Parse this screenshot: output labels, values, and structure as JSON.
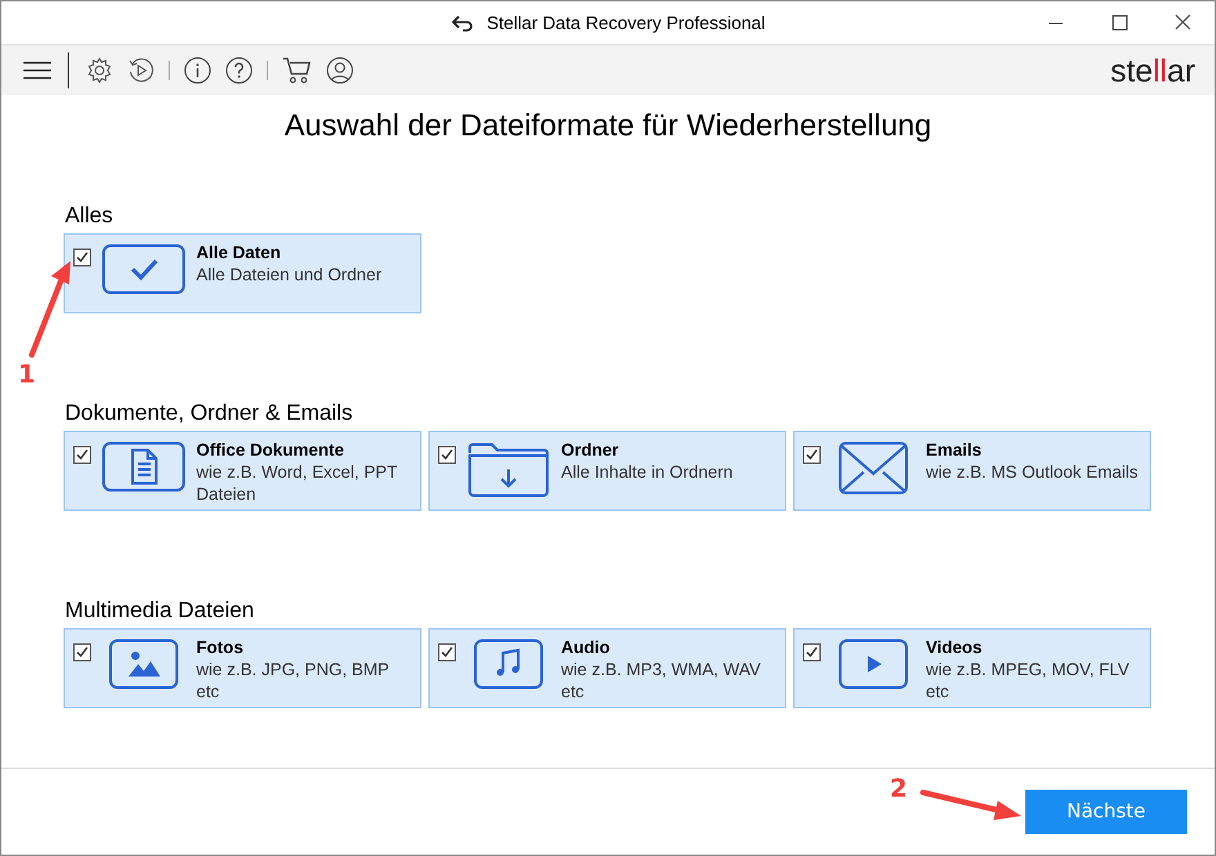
{
  "window": {
    "title": "Stellar Data Recovery Professional"
  },
  "toolbar": {
    "logo": {
      "before": "ste",
      "accent": "ll",
      "after": "ar"
    }
  },
  "heading": "Auswahl der Dateiformate für Wiederherstellung",
  "sections": [
    {
      "title": "Alles",
      "items": [
        {
          "kind": "all",
          "name": "Alle Daten",
          "description": "Alle Dateien und Ordner",
          "checked": true
        }
      ]
    },
    {
      "title": "Dokumente, Ordner & Emails",
      "items": [
        {
          "kind": "document",
          "name": "Office Dokumente",
          "description": "wie z.B. Word, Excel, PPT Dateien",
          "checked": true
        },
        {
          "kind": "folder",
          "name": "Ordner",
          "description": "Alle Inhalte in Ordnern",
          "checked": true
        },
        {
          "kind": "email",
          "name": "Emails",
          "description": "wie z.B. MS Outlook Emails",
          "checked": true
        }
      ]
    },
    {
      "title": "Multimedia Dateien",
      "items": [
        {
          "kind": "photo",
          "name": "Fotos",
          "description": "wie z.B. JPG, PNG, BMP etc",
          "checked": true
        },
        {
          "kind": "audio",
          "name": "Audio",
          "description": "wie z.B. MP3, WMA, WAV etc",
          "checked": true
        },
        {
          "kind": "video",
          "name": "Videos",
          "description": "wie z.B. MPEG, MOV, FLV etc",
          "checked": true
        }
      ]
    }
  ],
  "next_button": "Nächste",
  "annotations": [
    {
      "label": "1",
      "kind": "up"
    },
    {
      "label": "2",
      "kind": "right"
    }
  ]
}
